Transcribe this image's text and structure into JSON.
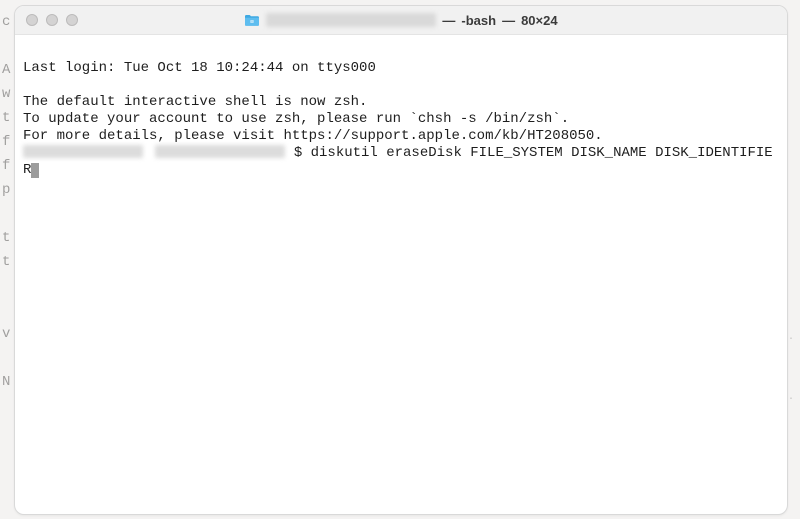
{
  "window": {
    "title_sep": " — ",
    "title_shell": "-bash",
    "title_size": "80×24"
  },
  "terminal": {
    "last_login": "Last login: Tue Oct 18 10:24:44 on ttys000",
    "zsh_notice_1": "The default interactive shell is now zsh.",
    "zsh_notice_2": "To update your account to use zsh, please run `chsh -s /bin/zsh`.",
    "zsh_notice_3": "For more details, please visit https://support.apple.com/kb/HT208050.",
    "prompt_separator": "$",
    "command": " diskutil eraseDisk FILE_SYSTEM DISK_NAME DISK_IDENTIFIER"
  },
  "bg_left": "c\n \nA\nw\nt\nf\nf\np\n \nt\nt\n \n \nv\n \nN\n \n \n \n "
}
